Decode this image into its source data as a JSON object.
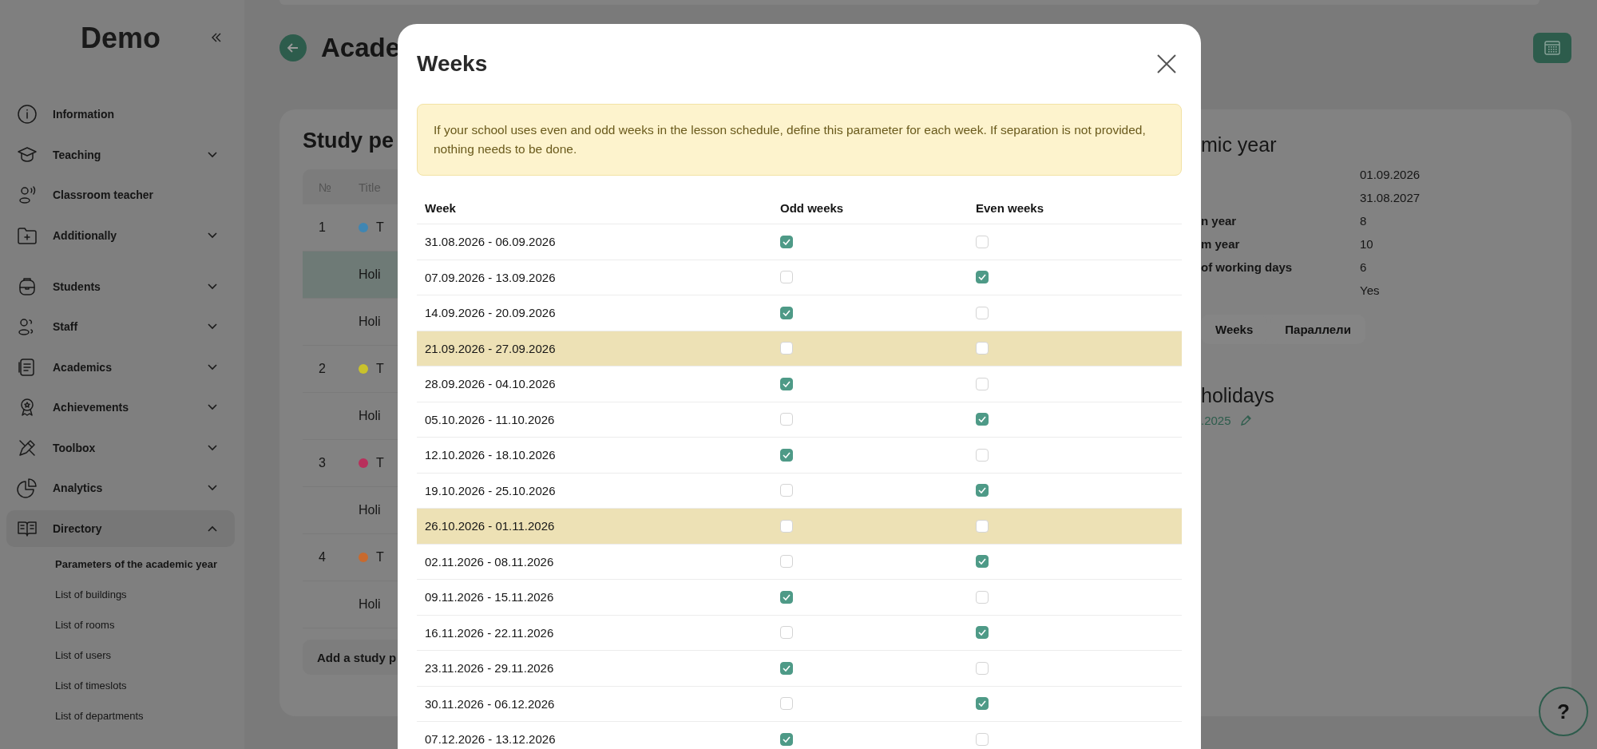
{
  "sidebar": {
    "logo": "Demo",
    "sections": [
      [
        {
          "label": "Information",
          "kind": "link"
        },
        {
          "label": "Teaching",
          "kind": "group",
          "expanded": false
        },
        {
          "label": "Classroom teacher",
          "kind": "link"
        },
        {
          "label": "Additionally",
          "kind": "group",
          "expanded": false
        }
      ],
      [
        {
          "label": "Students",
          "kind": "group",
          "expanded": false
        },
        {
          "label": "Staff",
          "kind": "group",
          "expanded": false
        },
        {
          "label": "Academics",
          "kind": "group",
          "expanded": false
        },
        {
          "label": "Achievements",
          "kind": "group",
          "expanded": false
        },
        {
          "label": "Toolbox",
          "kind": "group",
          "expanded": false
        },
        {
          "label": "Analytics",
          "kind": "group",
          "expanded": false
        },
        {
          "label": "Directory",
          "kind": "group",
          "expanded": true,
          "children": [
            {
              "label": "Parameters of the academic year",
              "selected": true
            },
            {
              "label": "List of buildings",
              "selected": false
            },
            {
              "label": "List of rooms",
              "selected": false
            },
            {
              "label": "List of users",
              "selected": false
            },
            {
              "label": "List of timeslots",
              "selected": false
            },
            {
              "label": "List of departments",
              "selected": false
            }
          ]
        }
      ]
    ]
  },
  "page": {
    "title": "Acade"
  },
  "periods_card": {
    "title": "Study pe",
    "columns": [
      "№",
      "Title"
    ],
    "rows": [
      {
        "kind": "period",
        "number": "1",
        "title": "T",
        "color": "#3f86b3",
        "selected": false
      },
      {
        "kind": "holiday",
        "title": "Holi",
        "selected": true
      },
      {
        "kind": "holiday",
        "title": "Holi",
        "selected": false
      },
      {
        "kind": "period",
        "number": "2",
        "title": "T",
        "color": "#c9c22c",
        "selected": false
      },
      {
        "kind": "holiday",
        "title": "Holi",
        "selected": false
      },
      {
        "kind": "period",
        "number": "3",
        "title": "T",
        "color": "#b8305c",
        "selected": false
      },
      {
        "kind": "holiday",
        "title": "Holi",
        "selected": false
      },
      {
        "kind": "period",
        "number": "4",
        "title": "T",
        "color": "#c86a2e",
        "selected": false
      },
      {
        "kind": "holiday",
        "title": "Holi",
        "selected": false
      }
    ],
    "add_button": "Add a study p"
  },
  "year_card": {
    "title": "mic year",
    "fields": [
      {
        "value": "01.09.2026"
      },
      {
        "value": "31.08.2027"
      },
      {
        "label": "n year",
        "value": "8"
      },
      {
        "label": "m year",
        "value": "10"
      },
      {
        "label": "of working days",
        "value": "6"
      },
      {
        "value": "Yes"
      }
    ],
    "tabs": [
      {
        "label": "Weeks"
      },
      {
        "label": "Параллели"
      }
    ],
    "holidays": {
      "title": "holidays",
      "date": ".2025"
    }
  },
  "weeks_modal": {
    "title": "Weeks",
    "notice": "If your school uses even and odd weeks in the lesson schedule, define this parameter for each week. If separation is not provided, nothing needs to be done.",
    "columns": [
      "Week",
      "Odd weeks",
      "Even weeks"
    ],
    "rows": [
      {
        "week": "31.08.2026 - 06.09.2026",
        "odd": true,
        "even": false,
        "highlighted": false
      },
      {
        "week": "07.09.2026 - 13.09.2026",
        "odd": false,
        "even": true,
        "highlighted": false
      },
      {
        "week": "14.09.2026 - 20.09.2026",
        "odd": true,
        "even": false,
        "highlighted": false
      },
      {
        "week": "21.09.2026 - 27.09.2026",
        "odd": false,
        "even": false,
        "highlighted": true
      },
      {
        "week": "28.09.2026 - 04.10.2026",
        "odd": true,
        "even": false,
        "highlighted": false
      },
      {
        "week": "05.10.2026 - 11.10.2026",
        "odd": false,
        "even": true,
        "highlighted": false
      },
      {
        "week": "12.10.2026 - 18.10.2026",
        "odd": true,
        "even": false,
        "highlighted": false
      },
      {
        "week": "19.10.2026 - 25.10.2026",
        "odd": false,
        "even": true,
        "highlighted": false
      },
      {
        "week": "26.10.2026 - 01.11.2026",
        "odd": false,
        "even": false,
        "highlighted": true
      },
      {
        "week": "02.11.2026 - 08.11.2026",
        "odd": false,
        "even": true,
        "highlighted": false
      },
      {
        "week": "09.11.2026 - 15.11.2026",
        "odd": true,
        "even": false,
        "highlighted": false
      },
      {
        "week": "16.11.2026 - 22.11.2026",
        "odd": false,
        "even": true,
        "highlighted": false
      },
      {
        "week": "23.11.2026 - 29.11.2026",
        "odd": true,
        "even": false,
        "highlighted": false
      },
      {
        "week": "30.11.2026 - 06.12.2026",
        "odd": false,
        "even": true,
        "highlighted": false
      },
      {
        "week": "07.12.2026 - 13.12.2026",
        "odd": true,
        "even": false,
        "highlighted": false
      }
    ]
  },
  "help_button": "?"
}
